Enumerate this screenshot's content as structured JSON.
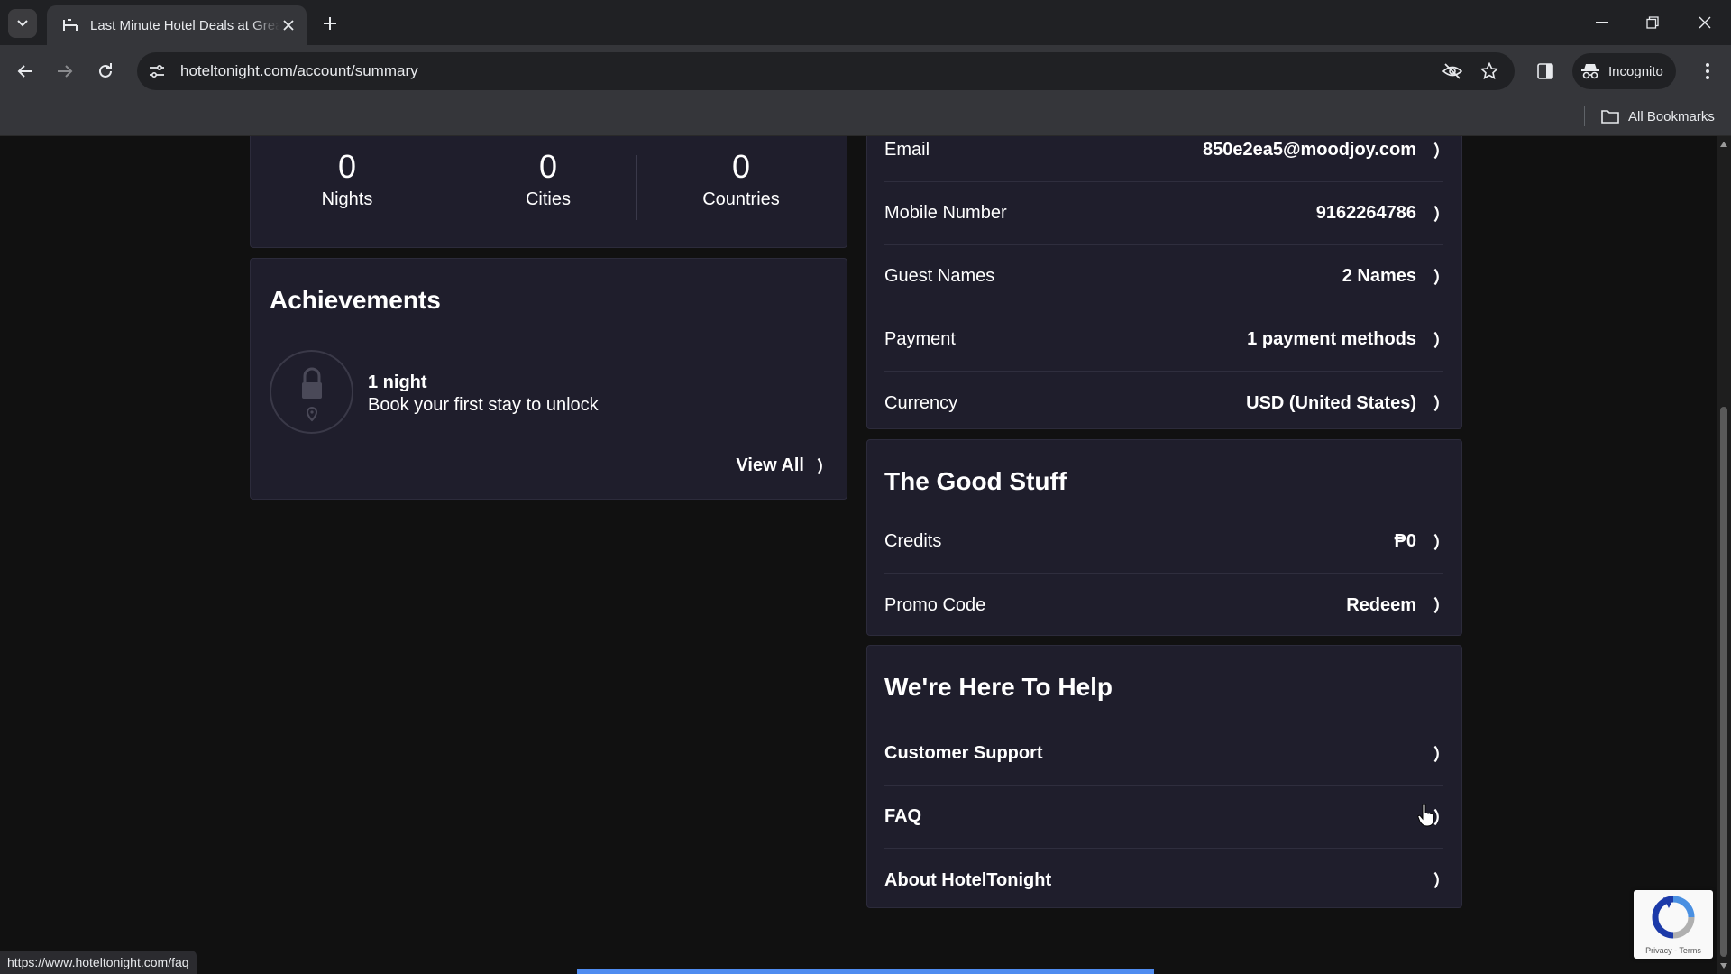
{
  "browser": {
    "tab_title": "Last Minute Hotel Deals at Great Prices",
    "url": "hoteltonight.com/account/summary",
    "incognito_label": "Incognito",
    "all_bookmarks_label": "All Bookmarks",
    "status_url": "https://www.hoteltonight.com/faq"
  },
  "stats": [
    {
      "value": "0",
      "label": "Nights"
    },
    {
      "value": "0",
      "label": "Cities"
    },
    {
      "value": "0",
      "label": "Countries"
    }
  ],
  "achievements": {
    "title": "Achievements",
    "item_name": "1 night",
    "item_desc": "Book your first stay to unlock",
    "view_all": "View All"
  },
  "account_rows": [
    {
      "label": "Email",
      "value": "850e2ea5@moodjoy.com"
    },
    {
      "label": "Mobile Number",
      "value": "9162264786"
    },
    {
      "label": "Guest Names",
      "value": "2 Names"
    },
    {
      "label": "Payment",
      "value": "1 payment methods"
    },
    {
      "label": "Currency",
      "value": "USD (United States)"
    }
  ],
  "good_stuff": {
    "title": "The Good Stuff",
    "rows": [
      {
        "label": "Credits",
        "value": "₱0"
      },
      {
        "label": "Promo Code",
        "value": "Redeem"
      }
    ]
  },
  "help": {
    "title": "We're Here To Help",
    "rows": [
      {
        "label": "Customer Support"
      },
      {
        "label": "FAQ"
      },
      {
        "label": "About HotelTonight"
      }
    ]
  },
  "recaptcha": {
    "footer": "Privacy - Terms"
  },
  "colors": {
    "card_bg": "#1f1e2c",
    "page_bg": "#111111",
    "accent_loading": "#4f8cf0"
  }
}
